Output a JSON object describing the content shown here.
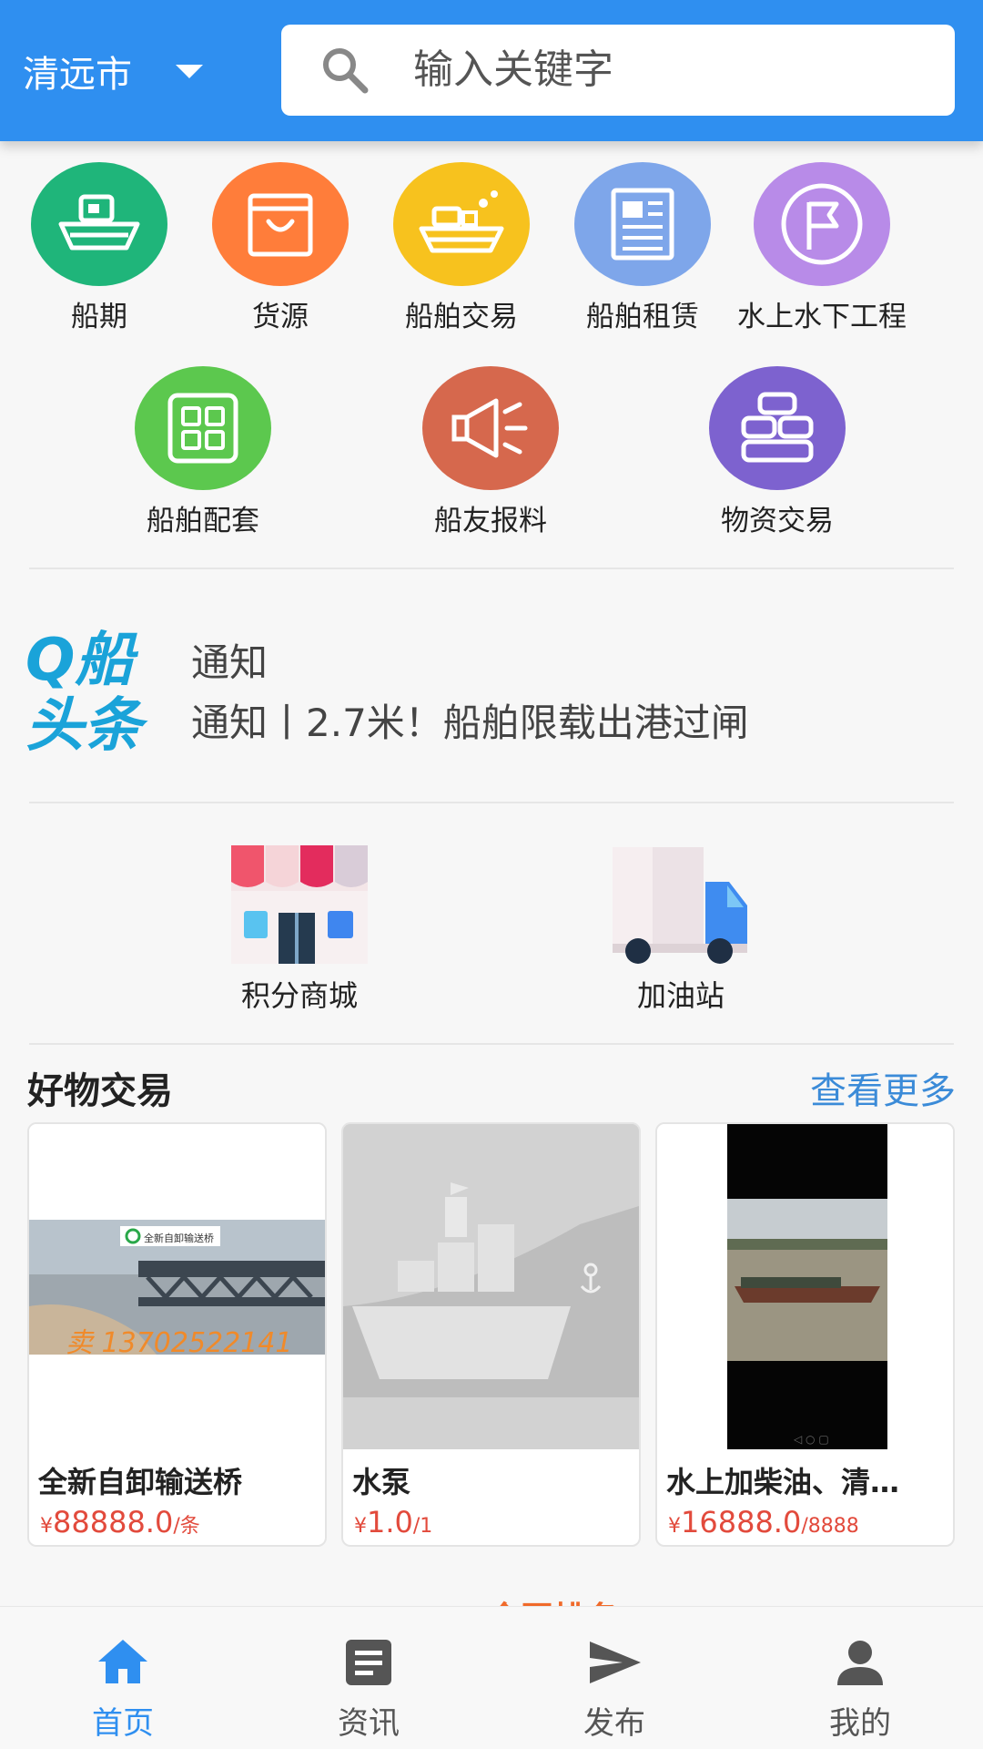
{
  "header": {
    "city": "清远市",
    "search_placeholder": "输入关键字"
  },
  "categories": [
    {
      "label": "船期",
      "color": "#1fb57a",
      "icon": "cargo-ship-icon"
    },
    {
      "label": "货源",
      "color": "#ff7d3a",
      "icon": "shopping-bag-icon"
    },
    {
      "label": "船舶交易",
      "color": "#f7c21e",
      "icon": "trade-ship-icon"
    },
    {
      "label": "船舶租赁",
      "color": "#7ea6ea",
      "icon": "document-icon"
    },
    {
      "label": "水上水下工程",
      "color": "#b88be8",
      "icon": "flag-icon"
    },
    {
      "label": "船舶配套",
      "color": "#5cc84e",
      "icon": "grid-icon"
    },
    {
      "label": "船友报料",
      "color": "#d6684d",
      "icon": "megaphone-icon"
    },
    {
      "label": "物资交易",
      "color": "#7d62cf",
      "icon": "blocks-icon"
    }
  ],
  "headlines": {
    "logo_text": [
      "Q船",
      "头条"
    ],
    "line1": "通知",
    "line2": "通知丨2.7米！船舶限载出港过闸"
  },
  "shortcuts": [
    {
      "label": "积分商城",
      "icon": "shop-icon"
    },
    {
      "label": "加油站",
      "icon": "truck-icon"
    }
  ],
  "goods": {
    "title": "好物交易",
    "more": "查看更多",
    "items": [
      {
        "name": "全新自卸输送桥",
        "currency": "¥",
        "price": "88888.0",
        "unit": "/条",
        "image_caption": "卖 13702522141"
      },
      {
        "name": "水泵",
        "currency": "¥",
        "price": "1.0",
        "unit": "/1"
      },
      {
        "name": "水上加柴油、清…",
        "currency": "¥",
        "price": "16888.0",
        "unit": "/8888"
      }
    ]
  },
  "section_peek": "全国排名",
  "nav": [
    {
      "label": "首页",
      "icon": "home-icon",
      "active": true
    },
    {
      "label": "资讯",
      "icon": "news-icon",
      "active": false
    },
    {
      "label": "发布",
      "icon": "send-icon",
      "active": false
    },
    {
      "label": "我的",
      "icon": "person-icon",
      "active": false
    }
  ],
  "colors": {
    "primary": "#2f8ff0",
    "price": "#e24a3c",
    "link": "#3b8bd8",
    "logo": "#1aa3d9"
  }
}
